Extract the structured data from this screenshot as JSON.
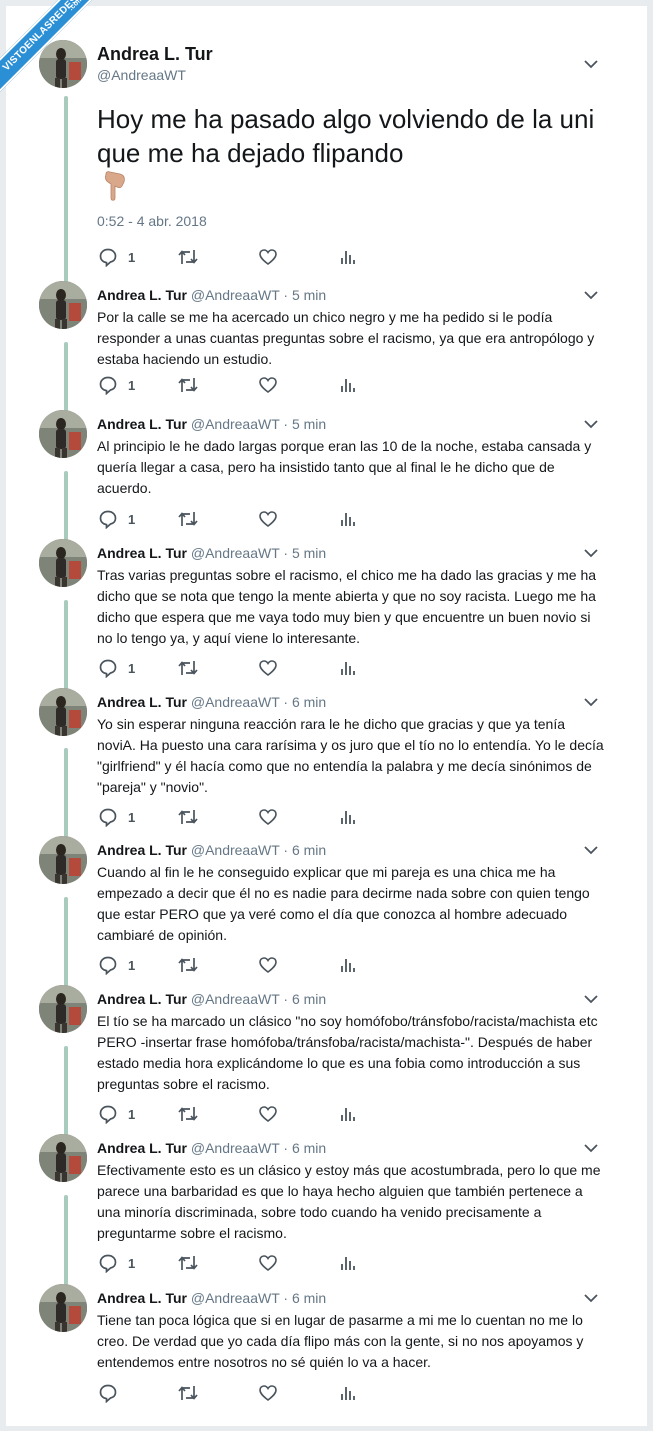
{
  "watermark": {
    "text": "VISTOENLASREDES",
    "suffix": ".com"
  },
  "author": {
    "name": "Andrea L. Tur",
    "handle": "@AndreaaWT"
  },
  "main_tweet": {
    "text": "Hoy me ha pasado algo volviendo de la uni que me ha dejado flipando",
    "emoji_icon": "pointing-down-hand-icon",
    "timestamp": "0:52 - 4 abr. 2018",
    "reply_count": "1"
  },
  "replies": [
    {
      "name": "Andrea L. Tur",
      "meta": "@AndreaaWT · 5 min",
      "text": "Por la calle se me ha acercado un chico negro y me ha pedido si le podía responder a unas cuantas preguntas sobre el racismo, ya que era antropólogo y estaba haciendo un estudio.",
      "reply_count": "1"
    },
    {
      "name": "Andrea L. Tur",
      "meta": "@AndreaaWT · 5 min",
      "text": "Al principio le he dado largas porque eran las 10 de la noche, estaba cansada y quería llegar a casa, pero ha insistido tanto que al final le he dicho que de acuerdo.",
      "reply_count": "1"
    },
    {
      "name": "Andrea L. Tur",
      "meta": "@AndreaaWT · 5 min",
      "text": "Tras varias preguntas sobre el racismo, el chico me ha dado las gracias y me ha dicho que se nota que tengo la mente abierta y que no soy racista. Luego me ha dicho que espera que me vaya todo muy bien y que encuentre un buen novio si no lo tengo ya, y aquí viene lo interesante.",
      "reply_count": "1"
    },
    {
      "name": "Andrea L. Tur",
      "meta": "@AndreaaWT · 6 min",
      "text": "Yo sin esperar ninguna reacción rara le he dicho que gracias y que ya tenía noviA. Ha puesto una cara rarísima y os juro que el tío no lo entendía. Yo le decía \"girlfriend\" y él hacía como que no entendía la palabra y me decía sinónimos de \"pareja\" y \"novio\".",
      "reply_count": "1"
    },
    {
      "name": "Andrea L. Tur",
      "meta": "@AndreaaWT · 6 min",
      "text": "Cuando al fin le he conseguido explicar que mi pareja es una chica me ha empezado a decir que él no es nadie para decirme nada sobre con quien tengo que estar PERO que ya veré como el día que conozca al hombre adecuado cambiaré de opinión.",
      "reply_count": "1"
    },
    {
      "name": "Andrea L. Tur",
      "meta": "@AndreaaWT · 6 min",
      "text": "El tío se ha marcado un clásico \"no soy homófobo/tránsfobo/racista/machista etc PERO -insertar frase homófoba/tránsfoba/racista/machista-\". Después de haber estado media hora explicándome lo que es una fobia como introducción a sus preguntas sobre el racismo.",
      "reply_count": "1"
    },
    {
      "name": "Andrea L. Tur",
      "meta": "@AndreaaWT · 6 min",
      "text": "Efectivamente esto es un clásico y estoy más que acostumbrada, pero lo que me parece una barbaridad es que lo haya hecho alguien que también pertenece a una minoría discriminada, sobre todo cuando ha venido precisamente a preguntarme sobre el racismo.",
      "reply_count": "1"
    },
    {
      "name": "Andrea L. Tur",
      "meta": "@AndreaaWT · 6 min",
      "text": "Tiene tan poca lógica que si en lugar de pasarme a mi me lo cuentan no me lo creo. De verdad que yo cada día flipo más con la gente, si no nos apoyamos y entendemos entre nosotros no sé quién lo va a hacer.",
      "reply_count": ""
    }
  ],
  "icons": {
    "reply": "reply-icon",
    "retweet": "retweet-icon",
    "like": "heart-icon",
    "analytics": "analytics-icon",
    "more": "chevron-down-icon"
  },
  "colors": {
    "thread_line": "#a9cbbd",
    "secondary_text": "#657786",
    "icon": "#4a545d",
    "watermark": "#2b8fd6"
  }
}
